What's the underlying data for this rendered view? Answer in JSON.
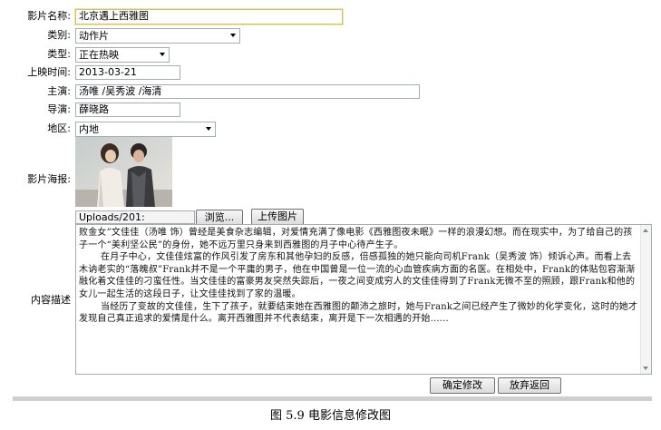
{
  "form": {
    "title_label": "影片名称:",
    "title_value": "北京遇上西雅图",
    "category_label": "类别:",
    "category_value": "动作片",
    "type_label": "类型:",
    "type_value": "正在热映",
    "release_label": "上映时间:",
    "release_value": "2013-03-21",
    "cast_label": "主演:",
    "cast_value": "汤唯 /吴秀波 /海清",
    "director_label": "导演:",
    "director_value": "薛晓路",
    "region_label": "地区:",
    "region_value": "内地",
    "poster_label": "影片海报:",
    "upload_path": "Uploads/201:",
    "browse_label": "浏览...",
    "upload_label": "上传图片",
    "desc_label": "内容描述",
    "desc_paragraphs": [
      "败金女”文佳佳（汤唯 饰）曾经是美食杂志编辑，对爱情充满了像电影《西雅图夜未眠》一样的浪漫幻想。而在现实中，为了给自己的孩子一个“美利坚公民”的身份，她不远万里只身来到西雅图的月子中心待产生子。",
      "在月子中心，文佳佳炫富的作风引发了房东和其他孕妇的反感，倍感孤独的她只能向司机Frank（吴秀波 饰）倾诉心声。而看上去木讷老实的“落魄叔”Frank并不是一个平庸的男子，他在中国曾是一位一流的心血管疾病方面的名医。在相处中，Frank的体贴包容渐渐融化着文佳佳的刁蛮任性。当文佳佳的富豪男友突然失踪后，一夜之间变成穷人的文佳佳得到了Frank无微不至的照顾，跟Frank和他的女儿一起生活的这段日子，让文佳佳找到了家的温暖。",
      "当经历了变故的文佳佳，生下了孩子，就要结束她在西雅图的颠沛之旅时，她与Frank之间已经产生了微妙的化学变化，这时的她才发现自己真正追求的爱情是什么。离开西雅图并不代表结束，离开是下一次相遇的开始……"
    ],
    "confirm_label": "确定修改",
    "back_label": "放弃返回"
  },
  "caption": "图 5.9 电影信息修改图",
  "colors": {
    "border": "#a5acb5",
    "focus": "#d4c060",
    "bar": "#cfcfcf"
  }
}
